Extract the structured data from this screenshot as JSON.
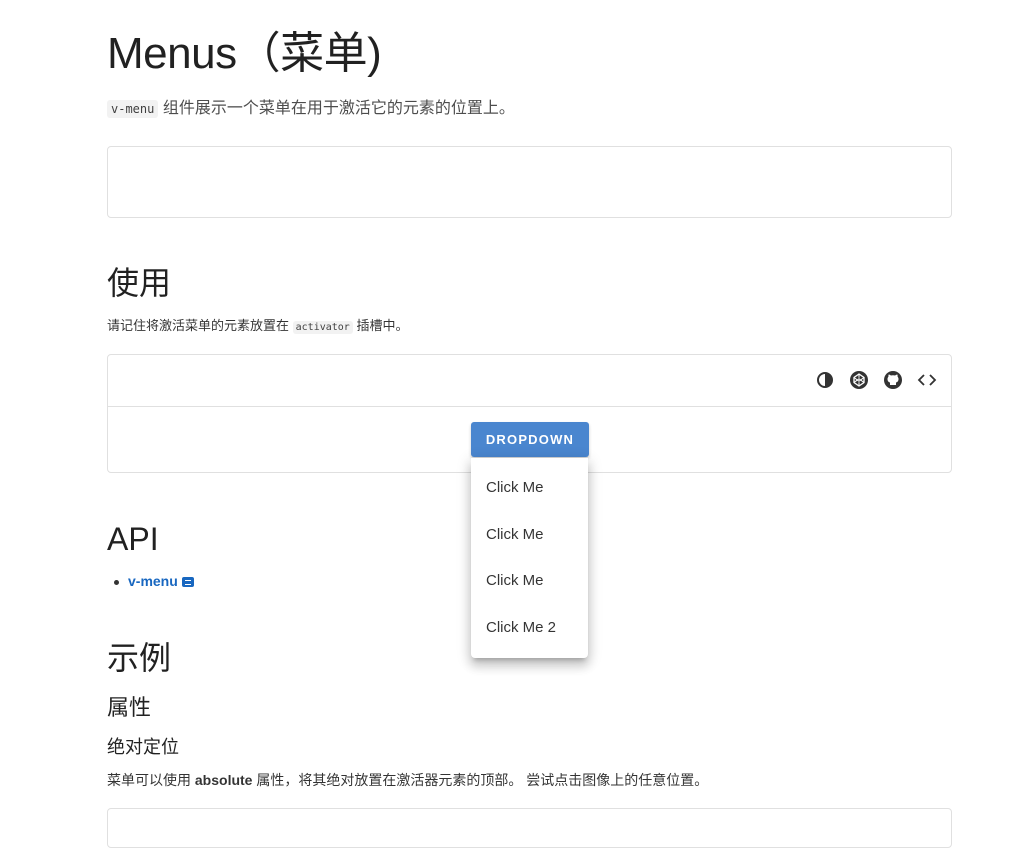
{
  "page": {
    "title": "Menus（菜单)",
    "intro_code": "v-menu",
    "intro_text": "组件展示一个菜单在用于激活它的元素的位置上。"
  },
  "usage": {
    "heading": "使用",
    "text_before": "请记住将激活菜单的元素放置在",
    "code": "activator",
    "text_after": "插槽中。",
    "toolbar_icons": [
      "invert-colors-icon",
      "codepen-icon",
      "github-icon",
      "code-icon"
    ],
    "button_label": "DROPDOWN",
    "button_color": "#4a86cf"
  },
  "menu": {
    "items": [
      "Click Me",
      "Click Me",
      "Click Me",
      "Click Me 2"
    ]
  },
  "api": {
    "heading": "API",
    "link_label": "v-menu",
    "link_color": "#1867c0"
  },
  "examples": {
    "heading": "示例",
    "subheading": "属性",
    "subsubheading": "绝对定位",
    "desc_before": "菜单可以使用",
    "desc_bold": "absolute",
    "desc_after": "属性，将其绝对放置在激活器元素的顶部。 尝试点击图像上的任意位置。"
  }
}
